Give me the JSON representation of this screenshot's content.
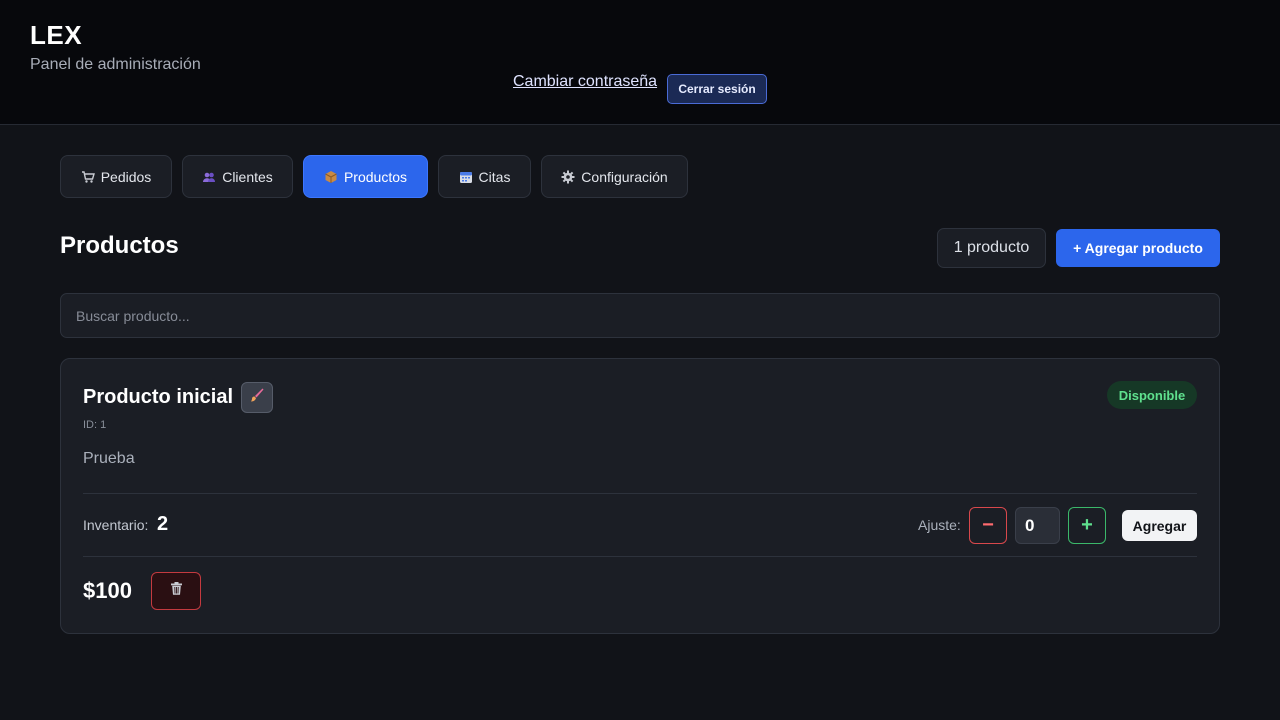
{
  "header": {
    "brand": "LEX",
    "subtitle": "Panel de administración",
    "change_password": "Cambiar contraseña",
    "logout": "Cerrar sesión"
  },
  "tabs": [
    {
      "label": "Pedidos",
      "icon": "cart-icon",
      "active": false
    },
    {
      "label": "Clientes",
      "icon": "users-icon",
      "active": false
    },
    {
      "label": "Productos",
      "icon": "package-icon",
      "active": true
    },
    {
      "label": "Citas",
      "icon": "calendar-icon",
      "active": false
    },
    {
      "label": "Configuración",
      "icon": "gear-icon",
      "active": false
    }
  ],
  "section": {
    "title": "Productos",
    "count": "1 producto",
    "add_label": "+ Agregar producto"
  },
  "search": {
    "value": "",
    "placeholder": "Buscar producto..."
  },
  "product": {
    "name": "Producto inicial",
    "id_label": "ID: 1",
    "description": "Prueba",
    "status": "Disponible",
    "inventory_label": "Inventario:",
    "inventory_value": "2",
    "adjust_label": "Ajuste:",
    "minus_label": "−",
    "adjust_value": "0",
    "plus_label": "+",
    "apply_label": "Agregar",
    "price": "$100",
    "edit_icon": "brush-icon",
    "delete_icon": "trash-icon"
  },
  "colors": {
    "background": "#111318",
    "header_bg": "#07080c",
    "card_bg": "#1b1e25",
    "accent": "#2c66ec",
    "success": "#5fe08e",
    "danger": "#d8484c"
  }
}
